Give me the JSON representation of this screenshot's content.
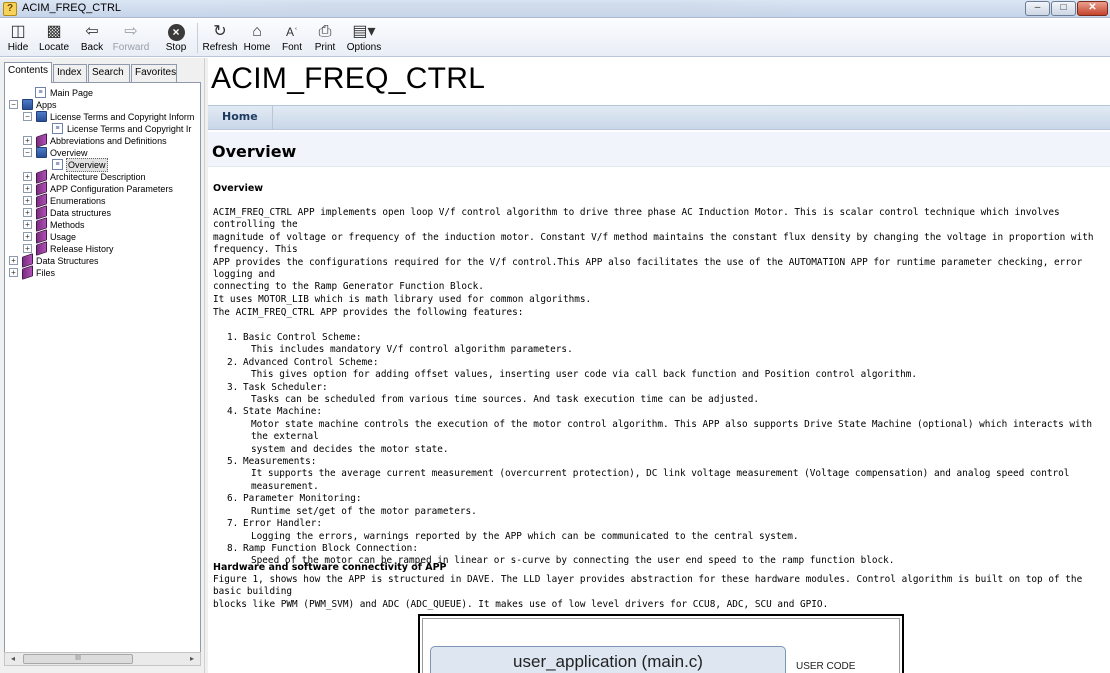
{
  "window": {
    "title": "ACIM_FREQ_CTRL",
    "buttons": {
      "minimize": "–",
      "maximize": "□",
      "close": "✕"
    }
  },
  "toolbar": {
    "hide": "Hide",
    "locate": "Locate",
    "back": "Back",
    "forward": "Forward",
    "stop": "Stop",
    "refresh": "Refresh",
    "home": "Home",
    "font": "Font",
    "print": "Print",
    "options": "Options"
  },
  "tabs": {
    "contents": "Contents",
    "index": "Index",
    "search": "Search",
    "favorites": "Favorites"
  },
  "tree": [
    {
      "label": "Main Page",
      "icon": "page-icon"
    },
    {
      "label": "Apps",
      "icon": "open-book-icon",
      "expander": "−"
    },
    {
      "label": "License Terms and Copyright Inform",
      "icon": "open-book-icon",
      "expander": "−"
    },
    {
      "label": "License Terms and Copyright Ir",
      "icon": "page-icon"
    },
    {
      "label": "Abbreviations and Definitions",
      "icon": "closed-book-icon",
      "expander": "+"
    },
    {
      "label": "Overview",
      "icon": "open-book-icon",
      "expander": "−"
    },
    {
      "label": "Overview",
      "icon": "page-icon",
      "selected": true
    },
    {
      "label": "Architecture Description",
      "icon": "closed-book-icon",
      "expander": "+"
    },
    {
      "label": "APP Configuration Parameters",
      "icon": "closed-book-icon",
      "expander": "+"
    },
    {
      "label": "Enumerations",
      "icon": "closed-book-icon",
      "expander": "+"
    },
    {
      "label": "Data structures",
      "icon": "closed-book-icon",
      "expander": "+"
    },
    {
      "label": "Methods",
      "icon": "closed-book-icon",
      "expander": "+"
    },
    {
      "label": "Usage",
      "icon": "closed-book-icon",
      "expander": "+"
    },
    {
      "label": "Release History",
      "icon": "closed-book-icon",
      "expander": "+"
    },
    {
      "label": "Data Structures",
      "icon": "closed-book-icon",
      "expander": "+"
    },
    {
      "label": "Files",
      "icon": "closed-book-icon",
      "expander": "+"
    }
  ],
  "scrollbar": {
    "left": "◂",
    "right": "▸",
    "grip": "III"
  },
  "content": {
    "page_title": "ACIM_FREQ_CTRL",
    "nav_home": "Home",
    "header_title": "Overview",
    "section_overview": "Overview",
    "intro_lines": [
      "ACIM_FREQ_CTRL APP implements open loop V/f control algorithm to drive three phase AC Induction Motor. This is scalar control technique which involves controlling the",
      "magnitude of voltage or frequency of the induction motor. Constant V/f method maintains the constant flux density by changing the voltage in proportion with frequency. This",
      "APP provides the configurations required for the V/f control.This APP also facilitates the use of the AUTOMATION APP for runtime parameter checking, error logging and",
      "connecting to the Ramp Generator Function Block.",
      "It uses MOTOR_LIB which is math library used for common algorithms."
    ],
    "features_intro": "The ACIM_FREQ_CTRL APP provides the following features:",
    "features": [
      {
        "num": "1.",
        "title": "Basic Control Scheme:",
        "desc": [
          "This includes mandatory V/f control algorithm parameters."
        ]
      },
      {
        "num": "2.",
        "title": "Advanced Control Scheme:",
        "desc": [
          "This gives option for adding offset values, inserting user code via call back function and Position control algorithm."
        ]
      },
      {
        "num": "3.",
        "title": "Task Scheduler:",
        "desc": [
          "Tasks can be scheduled from various time sources. And task execution time can be adjusted."
        ]
      },
      {
        "num": "4.",
        "title": "State Machine:",
        "desc": [
          "Motor state machine controls the execution of the motor control algorithm. This APP also supports Drive State Machine (optional) which interacts with the external",
          "system and decides the motor state."
        ]
      },
      {
        "num": "5.",
        "title": "Measurements:",
        "desc": [
          "It supports the average current measurement (overcurrent protection), DC link voltage measurement (Voltage compensation) and analog speed control measurement."
        ]
      },
      {
        "num": "6.",
        "title": "Parameter Monitoring:",
        "desc": [
          "Runtime set/get of the motor parameters."
        ]
      },
      {
        "num": "7.",
        "title": "Error Handler:",
        "desc": [
          "Logging the errors, warnings reported by the APP which can be communicated to the central system."
        ]
      },
      {
        "num": "8.",
        "title": "Ramp Function Block Connection:",
        "desc": [
          "Speed of the motor can be ramped in linear or s-curve by connecting the user end speed to the ramp function block."
        ]
      }
    ],
    "section_hw": "Hardware and software connectivity of APP",
    "hw_lines": [
      "Figure 1, shows how the APP is structured in DAVE. The LLD layer provides abstraction for these hardware modules. Control algorithm is built on top of the basic building",
      "blocks like PWM (PWM_SVM) and ADC (ADC_QUEUE). It makes use of low level drivers for CCU8, ADC, SCU and GPIO."
    ],
    "figure": {
      "user_app": "user_application (main.c)",
      "user_code": "USER CODE"
    }
  }
}
